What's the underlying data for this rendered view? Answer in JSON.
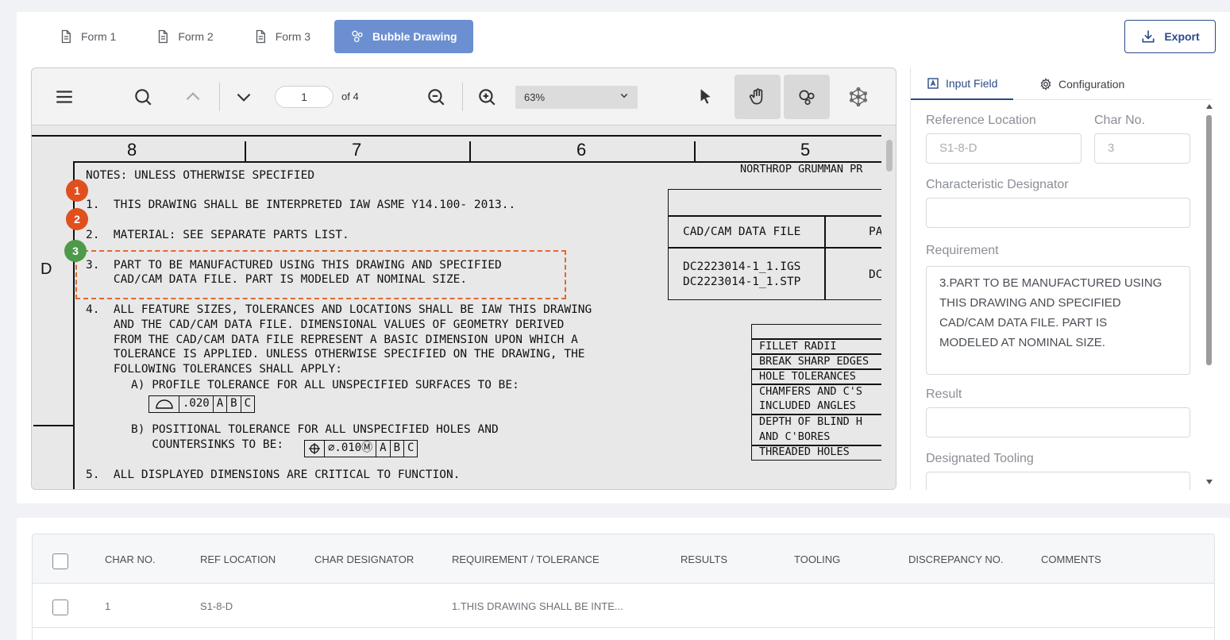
{
  "tabs": [
    {
      "label": "Form 1"
    },
    {
      "label": "Form 2"
    },
    {
      "label": "Form 3"
    },
    {
      "label": "Bubble Drawing"
    }
  ],
  "export_label": "Export",
  "viewer": {
    "page_current": "1",
    "page_of": "of 4",
    "zoom": "63%"
  },
  "drawing": {
    "columns": [
      "8",
      "7",
      "6",
      "5"
    ],
    "zone": "D",
    "header_right": "NORTHROP GRUMMAN PR",
    "notes_title": "NOTES: UNLESS OTHERWISE SPECIFIED",
    "note1": "1.  THIS DRAWING SHALL BE INTERPRETED IAW ASME Y14.100- 2013..",
    "note2": "2.  MATERIAL: SEE SEPARATE PARTS LIST.",
    "note3a": "3.  PART TO BE MANUFACTURED USING THIS DRAWING AND SPECIFIED",
    "note3b": "    CAD/CAM DATA FILE. PART IS MODELED AT NOMINAL SIZE.",
    "note4a": "4.  ALL FEATURE SIZES, TOLERANCES AND LOCATIONS SHALL BE IAW THIS DRAWING",
    "note4b": "    AND THE CAD/CAM DATA FILE. DIMENSIONAL VALUES OF GEOMETRY DERIVED",
    "note4c": "    FROM THE CAD/CAM DATA FILE REPRESENT A BASIC DIMENSION UPON WHICH A",
    "note4d": "    TOLERANCE IS APPLIED. UNLESS OTHERWISE SPECIFIED ON THE DRAWING, THE",
    "note4e": "    FOLLOWING TOLERANCES SHALL APPLY:",
    "note4A": "A) PROFILE TOLERANCE FOR ALL UNSPECIFIED SURFACES TO BE:",
    "note4A_fcf": [
      ".020",
      "A",
      "B",
      "C"
    ],
    "note4B1": "B) POSITIONAL TOLERANCE FOR ALL UNSPECIFIED HOLES AND",
    "note4B2": "   COUNTERSINKS TO BE:",
    "note4B_fcf": [
      "∅.010Ⓜ",
      "A",
      "B",
      "C"
    ],
    "note5": "5.  ALL DISPLAYED DIMENSIONS ARE CRITICAL TO FUNCTION.",
    "cad_header": "CAD/CAM DATA FILE",
    "cad_header2": "PA",
    "cad_file1": "DC2223014-1_1.IGS",
    "cad_file2": "DC2223014-1_1.STP",
    "cad_part": "DC",
    "tol_rows": [
      "FILLET RADII",
      "BREAK SHARP EDGES",
      "HOLE TOLERANCES",
      "CHAMFERS AND C'S",
      "INCLUDED ANGLES",
      "DEPTH OF BLIND H",
      "AND C'BORES",
      "THREADED HOLES"
    ],
    "bubbles": [
      {
        "n": "1",
        "color": "#e0501f"
      },
      {
        "n": "2",
        "color": "#e0501f"
      },
      {
        "n": "3",
        "color": "#4e9a4a"
      }
    ]
  },
  "side": {
    "tab_input": "Input Field",
    "tab_config": "Configuration",
    "ref_label": "Reference Location",
    "ref_value": "S1-8-D",
    "char_label": "Char No.",
    "char_value": "3",
    "designator_label": "Characteristic Designator",
    "designator_value": "",
    "requirement_label": "Requirement",
    "requirement_value": "3.PART TO BE MANUFACTURED USING\nTHIS DRAWING AND SPECIFIED\n CAD/CAM DATA FILE. PART IS\nMODELED AT NOMINAL SIZE.",
    "result_label": "Result",
    "result_value": "",
    "tooling_label": "Designated Tooling",
    "tooling_value": ""
  },
  "table": {
    "headers": [
      "CHAR NO.",
      "REF LOCATION",
      "CHAR DESIGNATOR",
      "REQUIREMENT / TOLERANCE",
      "RESULTS",
      "TOOLING",
      "DISCREPANCY NO.",
      "COMMENTS"
    ],
    "rows": [
      {
        "char_no": "1",
        "ref": "S1-8-D",
        "designator": "",
        "requirement": "1.THIS DRAWING SHALL BE INTE...",
        "results": "",
        "tooling": "",
        "discrepancy": "",
        "comments": ""
      }
    ]
  }
}
